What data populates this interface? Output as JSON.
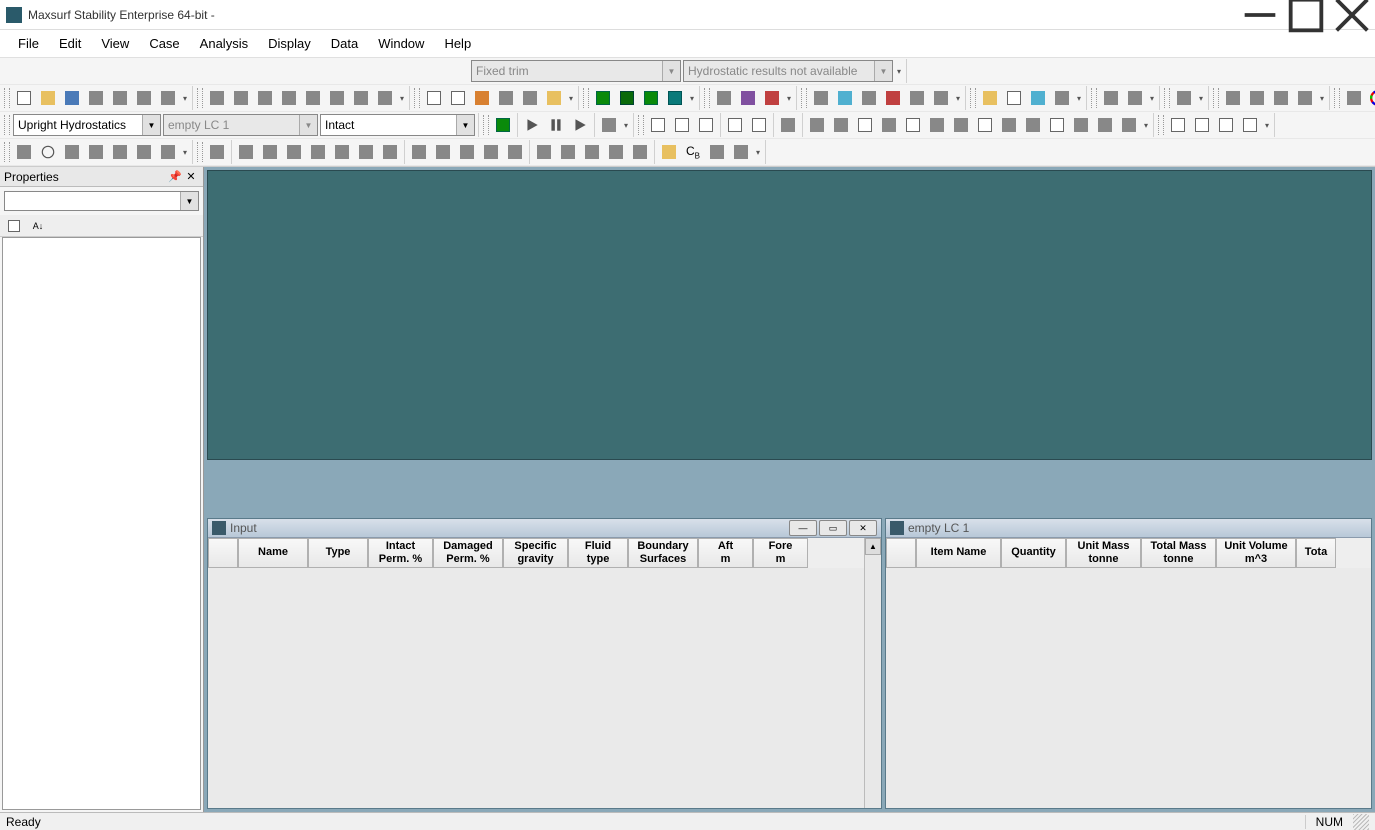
{
  "window": {
    "title": "Maxsurf Stability Enterprise 64-bit -"
  },
  "menu": [
    "File",
    "Edit",
    "View",
    "Case",
    "Analysis",
    "Display",
    "Data",
    "Window",
    "Help"
  ],
  "topCombos": {
    "trim": "Fixed trim",
    "results": "Hydrostatic results not available"
  },
  "analysisCombos": {
    "analysis": "Upright Hydrostatics",
    "loadcase": "empty LC 1",
    "condition": "Intact"
  },
  "propertiesPanel": {
    "title": "Properties",
    "filter": ""
  },
  "docWindows": {
    "input": {
      "title": "Input",
      "columns": [
        "",
        "Name",
        "Type",
        "Intact Perm. %",
        "Damaged Perm. %",
        "Specific gravity",
        "Fluid type",
        "Boundary Surfaces",
        "Aft m",
        "Fore m"
      ]
    },
    "loadcase": {
      "title": "empty LC 1",
      "columns": [
        "",
        "Item Name",
        "Quantity",
        "Unit Mass tonne",
        "Total Mass tonne",
        "Unit Volume m^3",
        "Tota"
      ]
    }
  },
  "statusbar": {
    "ready": "Ready",
    "num": "NUM"
  }
}
